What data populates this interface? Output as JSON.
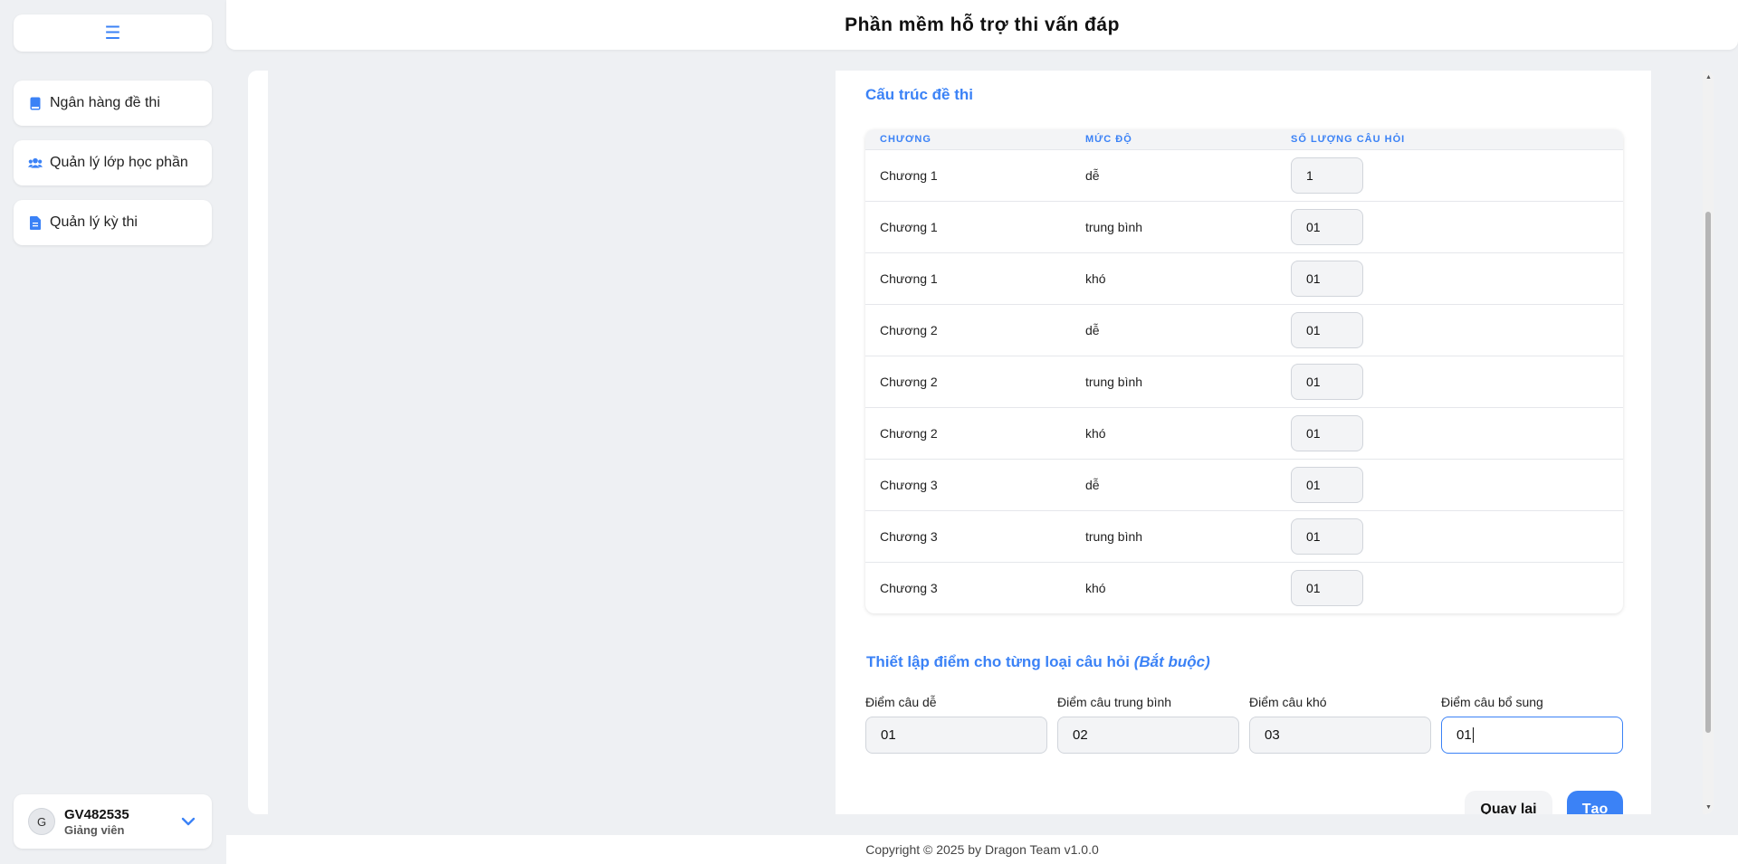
{
  "app": {
    "title": "Phần mềm hỗ trợ thi vấn đáp"
  },
  "sidebar": {
    "menu_icon": "hamburger-icon",
    "items": [
      {
        "label": "Ngân hàng đề thi",
        "icon": "book-icon"
      },
      {
        "label": "Quản lý lớp học phần",
        "icon": "users-icon"
      },
      {
        "label": "Quản lý kỳ thi",
        "icon": "document-icon"
      }
    ]
  },
  "user": {
    "initial": "G",
    "name": "GV482535",
    "role": "Giảng viên"
  },
  "structure": {
    "title": "Cấu trúc đề thi",
    "headers": [
      "CHƯƠNG",
      "MỨC ĐỘ",
      "SỐ LƯỢNG CÂU HỎI"
    ],
    "rows": [
      {
        "chapter": "Chương 1",
        "level": "dễ",
        "count": "1"
      },
      {
        "chapter": "Chương 1",
        "level": "trung bình",
        "count": "01"
      },
      {
        "chapter": "Chương 1",
        "level": "khó",
        "count": "01"
      },
      {
        "chapter": "Chương 2",
        "level": "dễ",
        "count": "01"
      },
      {
        "chapter": "Chương 2",
        "level": "trung bình",
        "count": "01"
      },
      {
        "chapter": "Chương 2",
        "level": "khó",
        "count": "01"
      },
      {
        "chapter": "Chương 3",
        "level": "dễ",
        "count": "01"
      },
      {
        "chapter": "Chương 3",
        "level": "trung bình",
        "count": "01"
      },
      {
        "chapter": "Chương 3",
        "level": "khó",
        "count": "01"
      }
    ]
  },
  "scores": {
    "title": "Thiết lập điểm cho từng loại câu hỏi",
    "title_note": "(Bắt buộc)",
    "fields": [
      {
        "label": "Điểm câu dễ",
        "value": "01"
      },
      {
        "label": "Điểm câu trung bình",
        "value": "02"
      },
      {
        "label": "Điểm câu khó",
        "value": "03"
      },
      {
        "label": "Điểm câu bổ sung",
        "value": "01"
      }
    ]
  },
  "actions": {
    "back": "Quay lại",
    "create": "Tạo"
  },
  "footer": {
    "text": "Copyright © 2025 by Dragon Team v1.0.0"
  },
  "colors": {
    "accent": "#3b82f6",
    "background": "#eef0f3"
  }
}
